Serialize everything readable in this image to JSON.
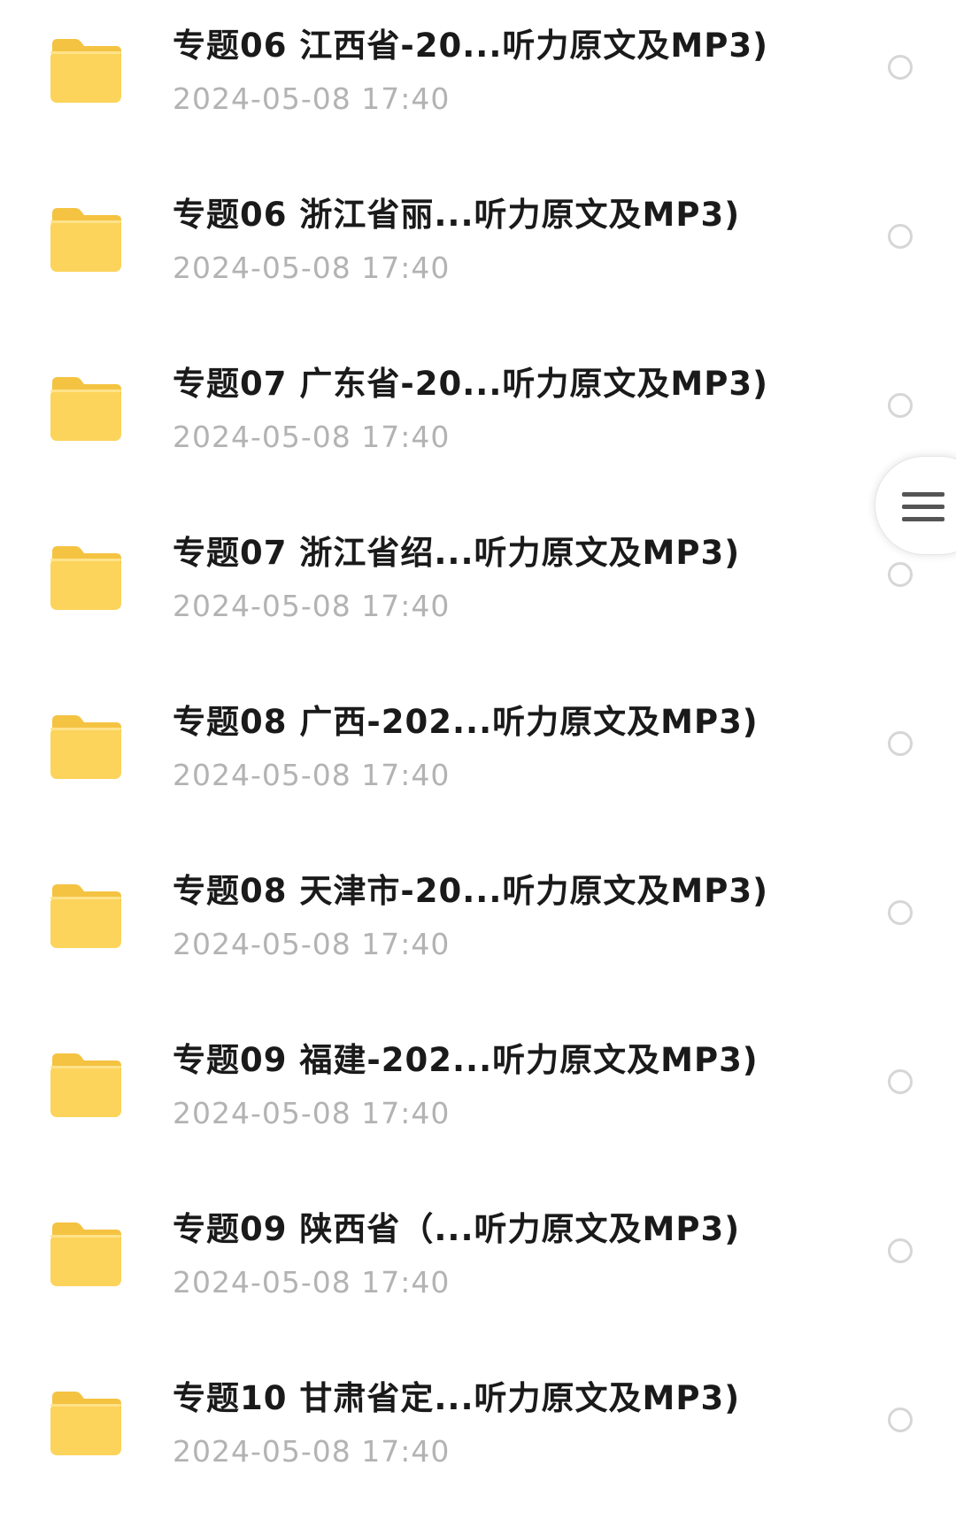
{
  "files": [
    {
      "name": "专题06 江西省-20...听力原文及MP3)",
      "date": "2024-05-08 17:40",
      "icon": "folder-icon"
    },
    {
      "name": "专题06 浙江省丽...听力原文及MP3)",
      "date": "2024-05-08 17:40",
      "icon": "folder-icon"
    },
    {
      "name": "专题07 广东省-20...听力原文及MP3)",
      "date": "2024-05-08 17:40",
      "icon": "folder-icon"
    },
    {
      "name": "专题07 浙江省绍...听力原文及MP3)",
      "date": "2024-05-08 17:40",
      "icon": "folder-icon"
    },
    {
      "name": "专题08 广西-202...听力原文及MP3)",
      "date": "2024-05-08 17:40",
      "icon": "folder-icon"
    },
    {
      "name": "专题08 天津市-20...听力原文及MP3)",
      "date": "2024-05-08 17:40",
      "icon": "folder-icon"
    },
    {
      "name": "专题09 福建-202...听力原文及MP3)",
      "date": "2024-05-08 17:40",
      "icon": "folder-icon"
    },
    {
      "name": "专题09 陕西省（...听力原文及MP3)",
      "date": "2024-05-08 17:40",
      "icon": "folder-icon"
    },
    {
      "name": "专题10 甘肃省定...听力原文及MP3)",
      "date": "2024-05-08 17:40",
      "icon": "folder-icon"
    }
  ],
  "floating_menu": {
    "icon": "menu-icon"
  },
  "colors": {
    "folder_body": "#FCD45B",
    "folder_back": "#F5C342",
    "title_text": "#1a1a1a",
    "date_text": "#b3b3b3",
    "radio_border": "#d6d6d6"
  }
}
